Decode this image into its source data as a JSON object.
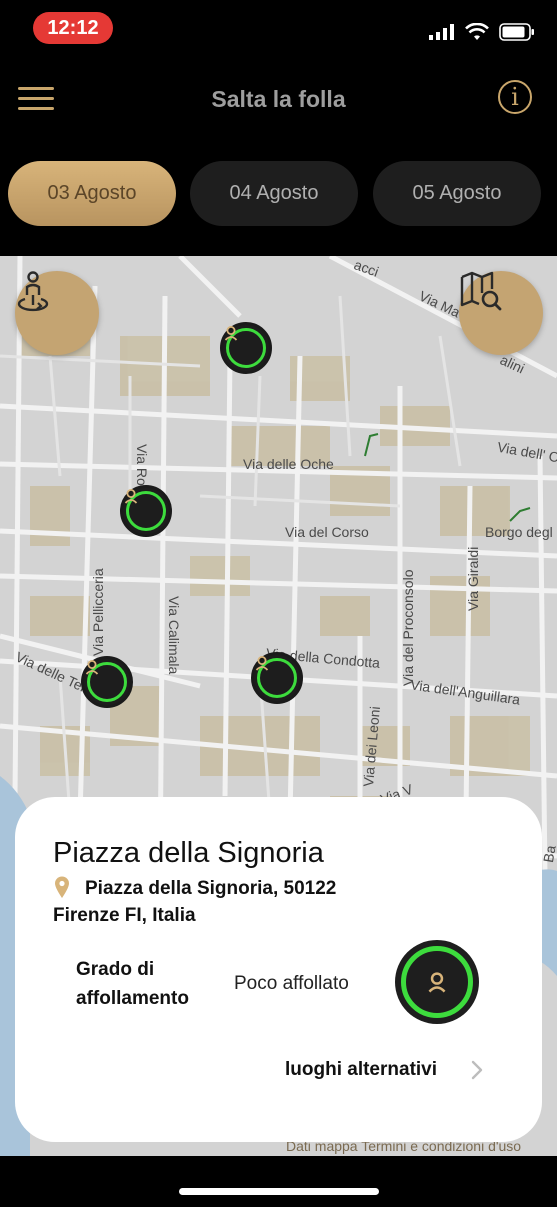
{
  "status_bar": {
    "time": "12:12"
  },
  "header": {
    "title": "Salta la folla",
    "info_glyph": "i"
  },
  "tabs": [
    {
      "label": "03 Agosto",
      "active": true
    },
    {
      "label": "04 Agosto",
      "active": false
    },
    {
      "label": "05 Agosto",
      "active": false
    }
  ],
  "map": {
    "street_labels": [
      "acci",
      "Via Ma",
      "alini",
      "Via dell' C",
      "Via Roma",
      "Via delle Oche",
      "Via del Corso",
      "Borgo degl",
      "Via del Proconsolo",
      "Via Giraldi",
      "Via Pellicceria",
      "Via Calimala",
      "Via della Condotta",
      "Via dell'Anguillara",
      "Via delle Terme",
      "Via dei Leoni",
      "Via V",
      "Ba"
    ],
    "marker_status": "Poco affollato",
    "credits": "Dati mappa   Termini e condizioni d'uso"
  },
  "card": {
    "place_name": "Piazza della Signoria",
    "address_line1": "Piazza della Signoria, 50122",
    "address_line2": "Firenze FI, Italia",
    "crowd_label": "Grado di affollamento",
    "crowd_value": "Poco affollato",
    "alternatives_label": "luoghi alternativi"
  },
  "colors": {
    "accent_gold": "#c9a66b",
    "status_green": "#3ddc3d",
    "background": "#000000",
    "alert_red": "#e53935"
  }
}
